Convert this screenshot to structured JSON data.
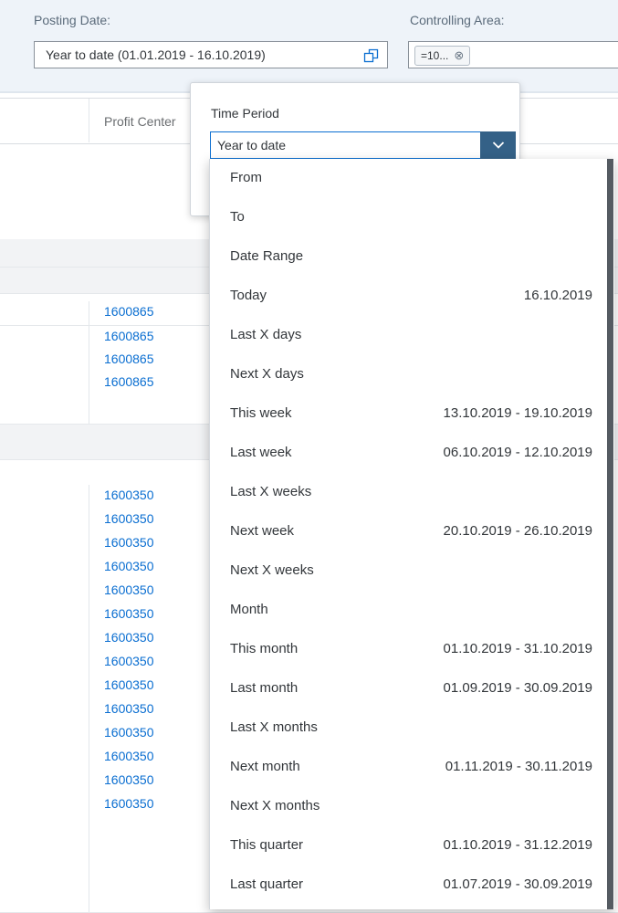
{
  "filters": {
    "posting_date_label": "Posting Date:",
    "posting_date_value": "Year to date (01.01.2019 - 16.10.2019)",
    "controlling_area_label": "Controlling Area:",
    "controlling_area_token": "=10..."
  },
  "table": {
    "profit_center_header": "Profit Center",
    "rows": [
      "1600865",
      "1600865",
      "1600865",
      "1600865",
      "1600350",
      "1600350",
      "1600350",
      "1600350",
      "1600350",
      "1600350",
      "1600350",
      "1600350",
      "1600350",
      "1600350",
      "1600350",
      "1600350",
      "1600350",
      "1600350"
    ]
  },
  "popover": {
    "time_period_label": "Time Period",
    "selected": "Year to date",
    "items": [
      {
        "label": "From",
        "range": ""
      },
      {
        "label": "To",
        "range": ""
      },
      {
        "label": "Date Range",
        "range": ""
      },
      {
        "label": "Today",
        "range": "16.10.2019"
      },
      {
        "label": "Last X days",
        "range": ""
      },
      {
        "label": "Next X days",
        "range": ""
      },
      {
        "label": "This week",
        "range": "13.10.2019 - 19.10.2019"
      },
      {
        "label": "Last week",
        "range": "06.10.2019 - 12.10.2019"
      },
      {
        "label": "Last X weeks",
        "range": ""
      },
      {
        "label": "Next week",
        "range": "20.10.2019 - 26.10.2019"
      },
      {
        "label": "Next X weeks",
        "range": ""
      },
      {
        "label": "Month",
        "range": ""
      },
      {
        "label": "This month",
        "range": "01.10.2019 - 31.10.2019"
      },
      {
        "label": "Last month",
        "range": "01.09.2019 - 30.09.2019"
      },
      {
        "label": "Last X months",
        "range": ""
      },
      {
        "label": "Next month",
        "range": "01.11.2019 - 30.11.2019"
      },
      {
        "label": "Next X months",
        "range": ""
      },
      {
        "label": "This quarter",
        "range": "01.10.2019 - 31.12.2019"
      },
      {
        "label": "Last quarter",
        "range": "01.07.2019 - 30.09.2019"
      }
    ]
  },
  "colors": {
    "link": "#0a6ed1",
    "select_button": "#346187",
    "filterbar_bg": "#eef3f9"
  }
}
